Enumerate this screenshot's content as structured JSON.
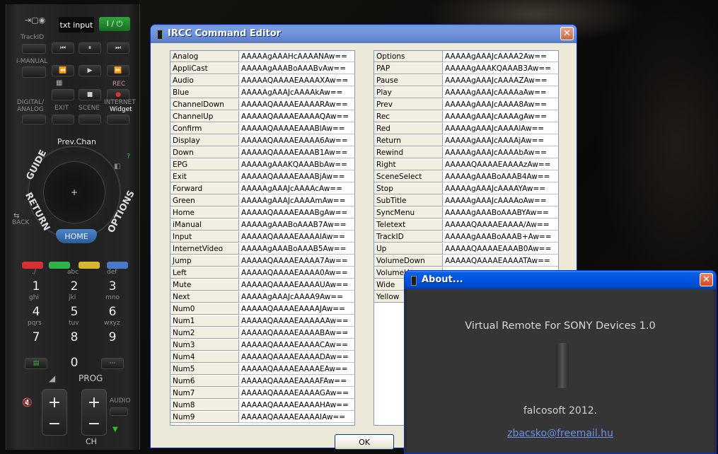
{
  "remote": {
    "txt_input": "txt input",
    "power": "I / ⏻",
    "labels": {
      "trackid": "TrackID",
      "imanual": "i-MANUAL",
      "rec": "REC",
      "digital_analog": "DIGITAL/ ANALOG",
      "exit": "EXIT",
      "scene": "SCENE",
      "internet": "INTERNET",
      "widget": "Widget",
      "prev_chan": "Prev.Chan",
      "guide": "GUIDE",
      "return": "RETURN",
      "options": "OPTIONS",
      "home": "HOME",
      "back": "BACK",
      "prog": "PROG",
      "audio": "AUDIO",
      "ch": "CH"
    },
    "numpad": [
      {
        "num": "1",
        "sub": "ghi",
        "top": "./"
      },
      {
        "num": "2",
        "sub": "jkl",
        "top": "abc"
      },
      {
        "num": "3",
        "sub": "mno",
        "top": "def"
      },
      {
        "num": "4",
        "sub": "pqrs",
        "top": ""
      },
      {
        "num": "5",
        "sub": "tuv",
        "top": ""
      },
      {
        "num": "6",
        "sub": "wxyz",
        "top": ""
      },
      {
        "num": "7",
        "sub": "",
        "top": ""
      },
      {
        "num": "8",
        "sub": "",
        "top": ""
      },
      {
        "num": "9",
        "sub": "",
        "top": ""
      },
      {
        "num": "0",
        "sub": "",
        "top": ""
      }
    ],
    "color_buttons": [
      "#d83030",
      "#2fb34a",
      "#d8b530",
      "#4a78c8"
    ],
    "plus": "+",
    "minus": "−"
  },
  "ircc_window": {
    "title": "IRCC Command Editor",
    "ok_label": "OK",
    "left_table": [
      [
        "Analog",
        "AAAAAgAAAHcAAAANAw=="
      ],
      [
        "AppliCast",
        "AAAAAgAAABoAAABvAw=="
      ],
      [
        "Audio",
        "AAAAAQAAAAEAAAAXAw=="
      ],
      [
        "Blue",
        "AAAAAgAAAJcAAAAkAw=="
      ],
      [
        "ChannelDown",
        "AAAAAQAAAAEAAAARAw=="
      ],
      [
        "ChannelUp",
        "AAAAAQAAAAEAAAAQAw=="
      ],
      [
        "Confirm",
        "AAAAAQAAAAEAAABlAw=="
      ],
      [
        "Display",
        "AAAAAQAAAAEAAAA6Aw=="
      ],
      [
        "Down",
        "AAAAAQAAAAEAAAB1Aw=="
      ],
      [
        "EPG",
        "AAAAAgAAAKQAAABbAw=="
      ],
      [
        "Exit",
        "AAAAAQAAAAEAAABjAw=="
      ],
      [
        "Forward",
        "AAAAAgAAAJcAAAAcAw=="
      ],
      [
        "Green",
        "AAAAAgAAAJcAAAAmAw=="
      ],
      [
        "Home",
        "AAAAAQAAAAEAAABgAw=="
      ],
      [
        "iManual",
        "AAAAAgAAABoAAAB7Aw=="
      ],
      [
        "Input",
        "AAAAAQAAAAEAAAAlAw=="
      ],
      [
        "InternetVideo",
        "AAAAAgAAABoAAAB5Aw=="
      ],
      [
        "Jump",
        "AAAAAQAAAAEAAAA7Aw=="
      ],
      [
        "Left",
        "AAAAAQAAAAEAAAA0Aw=="
      ],
      [
        "Mute",
        "AAAAAQAAAAEAAAAUAw=="
      ],
      [
        "Next",
        "AAAAAgAAAJcAAAA9Aw=="
      ],
      [
        "Num0",
        "AAAAAQAAAAEAAAAJAw=="
      ],
      [
        "Num1",
        "AAAAAQAAAAEAAAAAAw=="
      ],
      [
        "Num2",
        "AAAAAQAAAAEAAAABAw=="
      ],
      [
        "Num3",
        "AAAAAQAAAAEAAAACAw=="
      ],
      [
        "Num4",
        "AAAAAQAAAAEAAAADAw=="
      ],
      [
        "Num5",
        "AAAAAQAAAAEAAAAEAw=="
      ],
      [
        "Num6",
        "AAAAAQAAAAEAAAAFAw=="
      ],
      [
        "Num7",
        "AAAAAQAAAAEAAAAGAw=="
      ],
      [
        "Num8",
        "AAAAAQAAAAEAAAAHAw=="
      ],
      [
        "Num9",
        "AAAAAQAAAAEAAAAIAw=="
      ]
    ],
    "right_table": [
      [
        "Options",
        "AAAAAgAAAJcAAAA2Aw=="
      ],
      [
        "PAP",
        "AAAAAgAAAKQAAAB3Aw=="
      ],
      [
        "Pause",
        "AAAAAgAAAJcAAAAZAw=="
      ],
      [
        "Play",
        "AAAAAgAAAJcAAAAaAw=="
      ],
      [
        "Prev",
        "AAAAAgAAAJcAAAA8Aw=="
      ],
      [
        "Rec",
        "AAAAAgAAAJcAAAAgAw=="
      ],
      [
        "Red",
        "AAAAAgAAAJcAAAAlAw=="
      ],
      [
        "Return",
        "AAAAAgAAAJcAAAAjAw=="
      ],
      [
        "Rewind",
        "AAAAAgAAAJcAAAAbAw=="
      ],
      [
        "Right",
        "AAAAAQAAAAEAAAAzAw=="
      ],
      [
        "SceneSelect",
        "AAAAAgAAABoAAAB4Aw=="
      ],
      [
        "Stop",
        "AAAAAgAAAJcAAAAYAw=="
      ],
      [
        "SubTitle",
        "AAAAAgAAAJcAAAAoAw=="
      ],
      [
        "SyncMenu",
        "AAAAAgAAABoAAABYAw=="
      ],
      [
        "Teletext",
        "AAAAAQAAAAEAAAA/Aw=="
      ],
      [
        "TrackID",
        "AAAAAgAAABoAAAB+Aw=="
      ],
      [
        "Up",
        "AAAAAQAAAAEAAAB0Aw=="
      ],
      [
        "VolumeDown",
        "AAAAAQAAAAEAAAATAw=="
      ],
      [
        "VolumeU",
        ""
      ],
      [
        "Wide",
        ""
      ],
      [
        "Yellow",
        ""
      ]
    ]
  },
  "about_window": {
    "title": "About...",
    "heading": "Virtual Remote For SONY Devices  1.0",
    "author": "falcosoft 2012.",
    "email": "zbacsko@freemail.hu"
  }
}
